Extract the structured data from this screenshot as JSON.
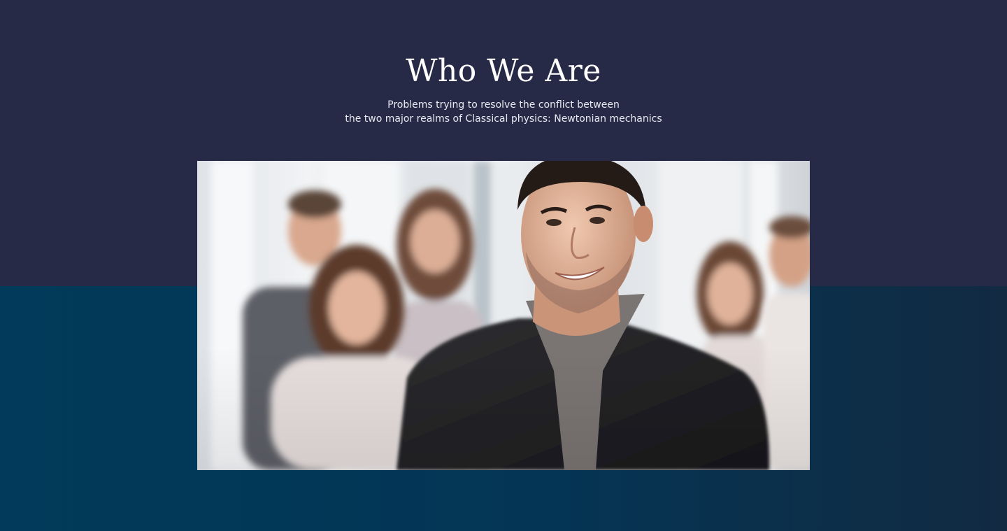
{
  "section": {
    "title": "Who We Are",
    "subtitle_line1": "Problems trying to resolve the conflict between",
    "subtitle_line2": "the two major realms of Classical physics: Newtonian mechanics"
  },
  "colors": {
    "top_background": "#262a47",
    "bottom_background": "#043554",
    "heading_text": "#ffffff"
  }
}
